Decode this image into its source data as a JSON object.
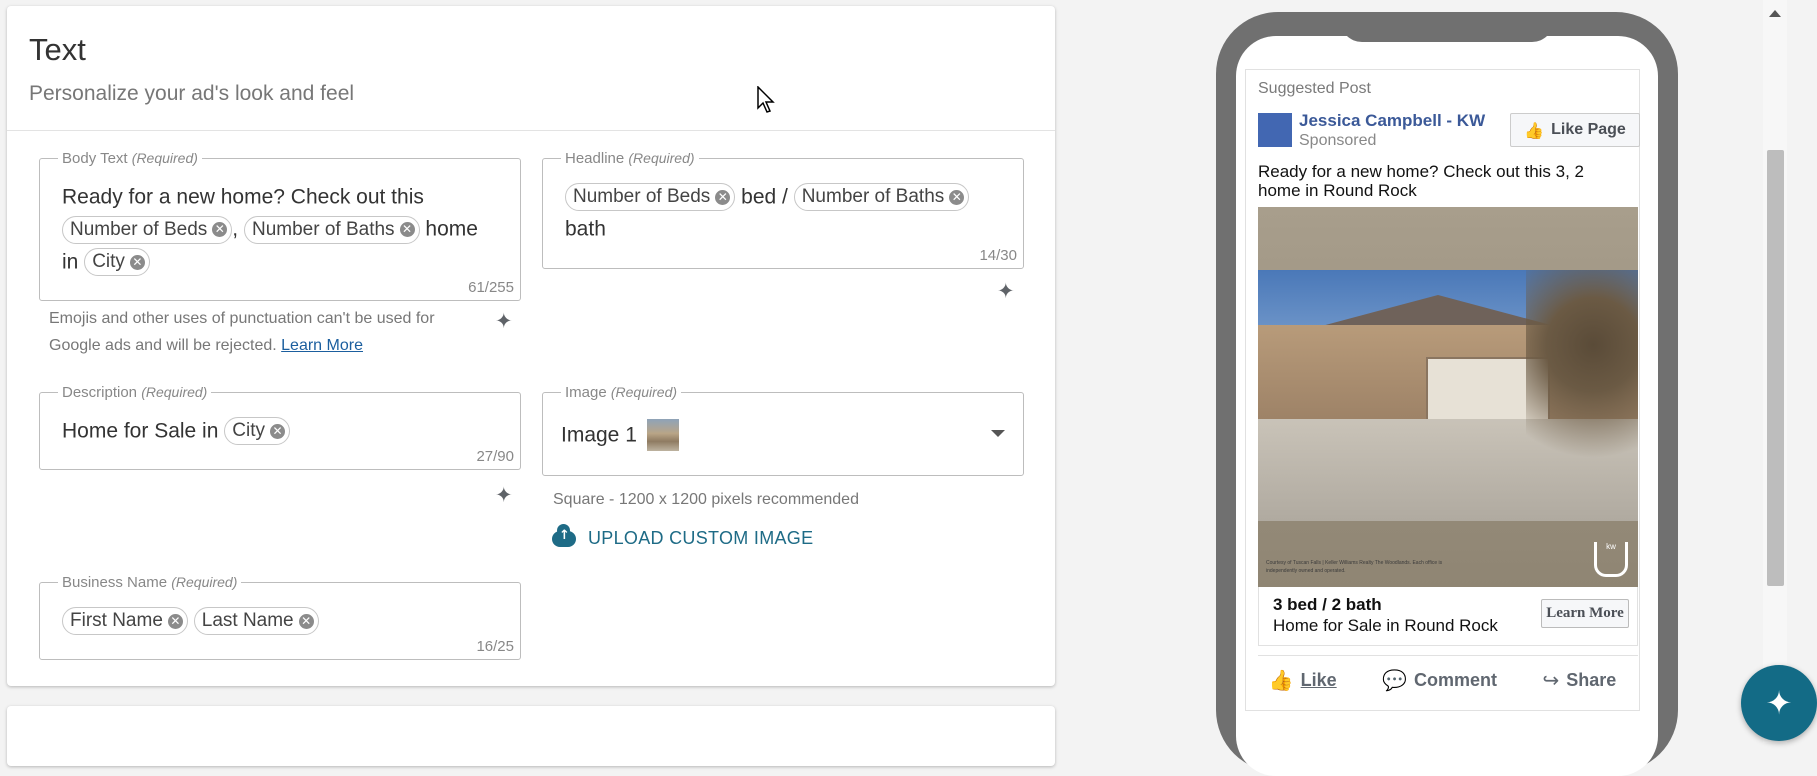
{
  "section": {
    "title": "Text",
    "subtitle": "Personalize your ad's look and feel"
  },
  "body_text": {
    "label": "Body Text",
    "required": "(Required)",
    "prefix": "Ready for a new home? Check out this",
    "chip_beds": "Number of Beds",
    "comma": ",",
    "chip_baths": "Number of Baths",
    "word_home": "home",
    "word_in": "in",
    "chip_city": "City",
    "counter": "61/255",
    "note": "Emojis and other uses of punctuation can't be used for Google ads and will be rejected.",
    "learn_more": "Learn More"
  },
  "headline": {
    "label": "Headline",
    "required": "(Required)",
    "chip_beds": "Number of Beds",
    "mid": "bed /",
    "chip_baths": "Number of Baths",
    "suffix": "bath",
    "counter": "14/30"
  },
  "description": {
    "label": "Description",
    "required": "(Required)",
    "prefix": "Home for Sale in",
    "chip_city": "City",
    "counter": "27/90"
  },
  "image": {
    "label": "Image",
    "required": "(Required)",
    "value": "Image 1",
    "hint": "Square - 1200 x 1200 pixels recommended",
    "upload": "UPLOAD CUSTOM IMAGE"
  },
  "business": {
    "label": "Business Name",
    "required": "(Required)",
    "chip_first": "First Name",
    "chip_last": "Last Name",
    "counter": "16/25"
  },
  "preview": {
    "suggested": "Suggested Post",
    "page_name": "Jessica Campbell - KW",
    "sponsored": "Sponsored",
    "like_page": "Like Page",
    "post_text": "Ready for a new home? Check out this 3, 2 home in Round Rock",
    "image_caption": "Courtesy of Tuscan Falls | Keller Williams Realty The Woodlands. Each office is independently owned and operated.",
    "logo_text": "kw",
    "footer_headline": "3 bed / 2 bath",
    "footer_desc": "Home for Sale in Round Rock",
    "learn_more": "Learn More",
    "like": "Like",
    "comment": "Comment",
    "share": "Share"
  },
  "icons": {
    "sparkle": "sparkle-icon",
    "remove": "close-circle-icon",
    "upload": "cloud-upload-icon",
    "caret": "chevron-down-icon",
    "thumb": "thumbs-up-icon",
    "comment": "comment-icon",
    "share": "share-icon"
  },
  "colors": {
    "accent": "#136b86",
    "link": "#1b5e9e",
    "facebook_blue": "#3b5998"
  }
}
